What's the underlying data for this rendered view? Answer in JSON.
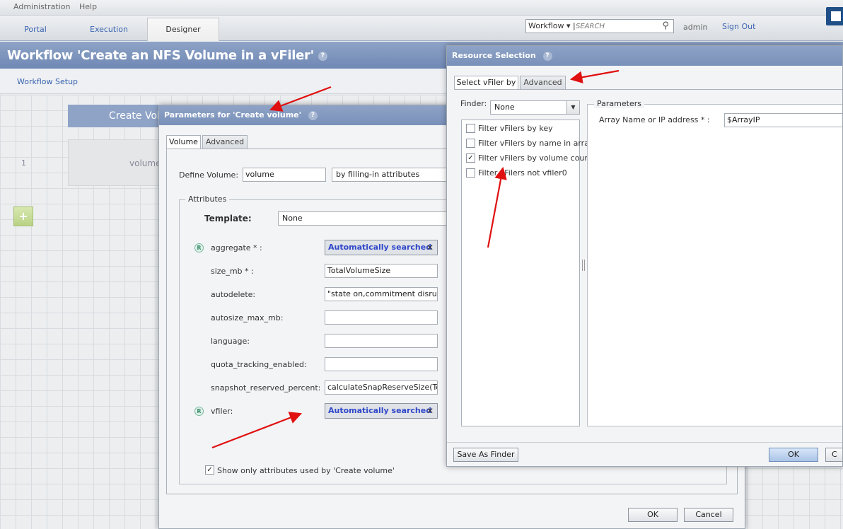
{
  "menubar": {
    "items": [
      "Administration",
      "Help"
    ]
  },
  "nav": {
    "tabs": [
      {
        "label": "Portal",
        "active": false
      },
      {
        "label": "Execution",
        "active": false
      },
      {
        "label": "Designer",
        "active": true
      }
    ],
    "search": {
      "scope": "Workflow ▾ |",
      "placeholder": "SEARCH"
    },
    "user": "admin",
    "sign_out": "Sign Out"
  },
  "page": {
    "title": "Workflow 'Create an NFS Volume in a vFiler'",
    "subnav": "Workflow Setup",
    "row_number": "1",
    "command_header": "Create Vol",
    "command_cell": "volume",
    "add_row": "+"
  },
  "params_dialog": {
    "title": "Parameters for 'Create volume'",
    "tabs": [
      "Volume",
      "Advanced"
    ],
    "define_label": "Define Volume:",
    "define_value": "volume",
    "define_mode": "by filling-in attributes",
    "attributes_legend": "Attributes",
    "template_label": "Template:",
    "template_value": "None",
    "attributes": [
      {
        "name": "aggregate * :",
        "value": "Automatically searched",
        "auto": true,
        "badge": "R"
      },
      {
        "name": "size_mb * :",
        "value": "TotalVolumeSize"
      },
      {
        "name": "autodelete:",
        "value": "\"state on,commitment disrupt,tri"
      },
      {
        "name": "autosize_max_mb:",
        "value": ""
      },
      {
        "name": "language:",
        "value": ""
      },
      {
        "name": "quota_tracking_enabled:",
        "value": ""
      },
      {
        "name": "snapshot_reserved_percent:",
        "value": "calculateSnapReserveSize(TotalV"
      },
      {
        "name": "vfiler:",
        "value": "Automatically searched",
        "auto": true,
        "badge": "R"
      }
    ],
    "remove_glyph": "✕",
    "show_only_label": "Show only attributes used by 'Create volume'",
    "ok": "OK",
    "cancel": "Cancel"
  },
  "resource_dialog": {
    "title": "Resource Selection",
    "tabs": [
      "Select vFiler by",
      "Advanced"
    ],
    "finder_label": "Finder:",
    "finder_value": "None",
    "filters": [
      {
        "label": "Filter vFilers by key",
        "checked": false
      },
      {
        "label": "Filter vFilers by name in array",
        "checked": false
      },
      {
        "label": "Filter vFilers by volume count",
        "checked": true
      },
      {
        "label": "Filter vFilers not vfiler0",
        "checked": false
      }
    ],
    "parameters_legend": "Parameters",
    "param_label": "Array Name or IP address * :",
    "param_value": "$ArrayIP",
    "save_as_finder": "Save As Finder",
    "ok": "OK",
    "cancel": "C"
  },
  "colors": {
    "accent": "#7990b9",
    "link": "#3a64b0",
    "auto_text": "#2f47c9",
    "annotation_arrow": "#e01010"
  }
}
